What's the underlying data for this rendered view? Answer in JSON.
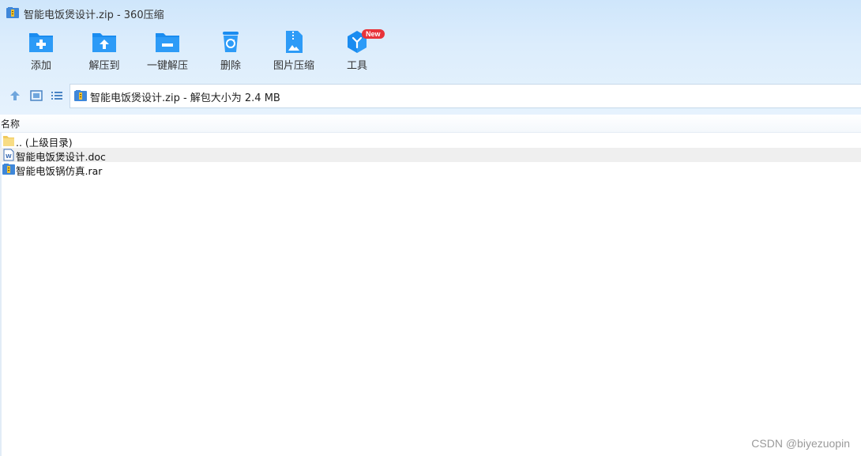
{
  "window": {
    "title": "智能电饭煲设计.zip - 360压缩"
  },
  "toolbar": {
    "items": [
      {
        "label": "添加",
        "icon": "add-folder-icon"
      },
      {
        "label": "解压到",
        "icon": "extract-to-icon"
      },
      {
        "label": "一键解压",
        "icon": "one-click-extract-icon"
      },
      {
        "label": "删除",
        "icon": "delete-trash-icon"
      },
      {
        "label": "图片压缩",
        "icon": "image-compress-icon"
      },
      {
        "label": "工具",
        "icon": "tools-cube-icon",
        "badge": "New"
      }
    ]
  },
  "navbar": {
    "path_text": "智能电饭煲设计.zip - 解包大小为 2.4 MB"
  },
  "file_list": {
    "column_name": "名称",
    "rows": [
      {
        "name": ".. (上级目录)",
        "icon": "parent-folder-icon",
        "selected": false
      },
      {
        "name": "智能电饭煲设计.doc",
        "icon": "word-document-icon",
        "selected": true
      },
      {
        "name": "智能电饭锅仿真.rar",
        "icon": "rar-archive-icon",
        "selected": false
      }
    ]
  },
  "watermark": "CSDN @biyezuopin",
  "colors": {
    "accent_blue": "#1a8cf0",
    "badge_red": "#e8333a",
    "toolbar_bg": "#dcedfc"
  }
}
